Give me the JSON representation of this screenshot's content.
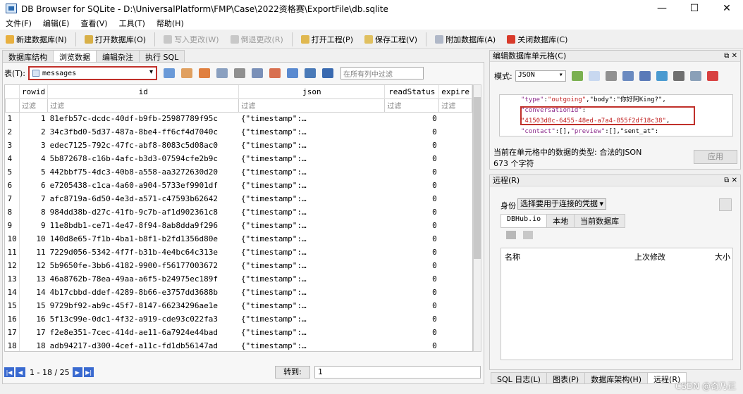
{
  "window": {
    "title": "DB Browser for SQLite - D:\\UniversalPlatform\\FMP\\Case\\2022资格赛\\ExportFile\\db.sqlite",
    "min": "—",
    "max": "☐",
    "close": "✕"
  },
  "menu": [
    "文件(F)",
    "编辑(E)",
    "查看(V)",
    "工具(T)",
    "帮助(H)"
  ],
  "toolbar": {
    "new_db": "新建数据库(N)",
    "open_db": "打开数据库(O)",
    "write": "写入更改(W)",
    "revert": "倒退更改(R)",
    "open_project": "打开工程(P)",
    "save_project": "保存工程(V)",
    "attach": "附加数据库(A)",
    "close_db": "关闭数据库(C)"
  },
  "tabs": [
    "数据库结构",
    "浏览数据",
    "编辑杂注",
    "执行 SQL"
  ],
  "browse": {
    "table_label": "表(T):",
    "table_value": "messages",
    "filter_placeholder": "在所有列中过滤",
    "columns": [
      "rowid",
      "id",
      "json",
      "readStatus",
      "expire"
    ],
    "filter_text": "过滤",
    "rows": [
      [
        "1",
        "1",
        "81efb57c-dcdc-40df-b9fb-25987789f95c",
        "{\"timestamp\":…",
        "0"
      ],
      [
        "2",
        "2",
        "34c3fbd0-5d37-487a-8be4-ff6cf4d7040c",
        "{\"timestamp\":…",
        "0"
      ],
      [
        "3",
        "3",
        "edec7125-792c-47fc-abf8-8083c5d08ac0",
        "{\"timestamp\":…",
        "0"
      ],
      [
        "4",
        "4",
        "5b872678-c16b-4afc-b3d3-07594cfe2b9c",
        "{\"timestamp\":…",
        "0"
      ],
      [
        "5",
        "5",
        "442bbf75-4dc3-40b8-a558-aa3272630d20",
        "{\"timestamp\":…",
        "0"
      ],
      [
        "6",
        "6",
        "e7205438-c1ca-4a60-a904-5733ef9901df",
        "{\"timestamp\":…",
        "0"
      ],
      [
        "7",
        "7",
        "afc8719a-6d50-4e3d-a571-c47593b62642",
        "{\"timestamp\":…",
        "0"
      ],
      [
        "8",
        "8",
        "984dd38b-d27c-41fb-9c7b-af1d902361c8",
        "{\"timestamp\":…",
        "0"
      ],
      [
        "9",
        "9",
        "11e8bdb1-ce71-4e47-8f94-8ab8dda9f296",
        "{\"timestamp\":…",
        "0"
      ],
      [
        "10",
        "10",
        "140d8e65-7f1b-4ba1-b8f1-b2fd1356d80e",
        "{\"timestamp\":…",
        "0"
      ],
      [
        "11",
        "11",
        "7229d056-5342-4f7f-b31b-4e4bc64c313e",
        "{\"timestamp\":…",
        "0"
      ],
      [
        "12",
        "12",
        "5b9650fe-3bb6-4182-9900-f56177003672",
        "{\"timestamp\":…",
        "0"
      ],
      [
        "13",
        "13",
        "46a8762b-78ea-49aa-a6f5-b24975ec189f",
        "{\"timestamp\":…",
        "0"
      ],
      [
        "14",
        "14",
        "4b17cbbd-ddef-4289-8b66-e3757dd3688b",
        "{\"timestamp\":…",
        "0"
      ],
      [
        "15",
        "15",
        "9729bf92-ab9c-45f7-8147-66234296ae1e",
        "{\"timestamp\":…",
        "0"
      ],
      [
        "16",
        "16",
        "5f13c99e-0dc1-4f32-a919-cde93c022fa3",
        "{\"timestamp\":…",
        "0"
      ],
      [
        "17",
        "17",
        "f2e8e351-7cec-414d-ae11-6a7924e44bad",
        "{\"timestamp\":…",
        "0"
      ],
      [
        "18",
        "18",
        "adb94217-d300-4cef-a11c-fd1db56147ad",
        "{\"timestamp\":…",
        "0"
      ]
    ],
    "nav_text": "1 - 18 / 25",
    "goto_label": "转到:",
    "goto_value": "1"
  },
  "edit_cell": {
    "title": "编辑数据库单元格(C)",
    "mode_label": "模式:",
    "mode_value": "JSON",
    "lines": [
      {
        "k": "\"type\"",
        "p": ":",
        "v": "\"outgoing\"",
        "r": ",\"body\":\"你好阿King?\","
      },
      {
        "k": "\"conversationId\"",
        "p": ":",
        "v": "",
        "r": ""
      },
      {
        "k": "",
        "p": "",
        "v": "\"41503d8c-6455-48ed-a7a4-855f2df18c38\"",
        "r": ","
      },
      {
        "k": "\"contact\"",
        "p": ":[],",
        "v": "\"preview\"",
        "r": ":[],\"sent_at\":"
      }
    ],
    "type_text": "当前在单元格中的数据的类型: 合法的JSON",
    "size_text": "673 个字符",
    "apply": "应用"
  },
  "remote": {
    "title": "远程(R)",
    "identity_label": "身份",
    "identity_value": "选择要用于连接的凭据",
    "tabs": [
      "DBHub.io",
      "本地",
      "当前数据库"
    ],
    "col_name": "名称",
    "col_modified": "上次修改",
    "col_size": "大小"
  },
  "bottom_tabs": [
    "SQL 日志(L)",
    "图表(P)",
    "数据库架构(H)",
    "远程(R)"
  ],
  "watermark": "CSDN @奇乃正"
}
